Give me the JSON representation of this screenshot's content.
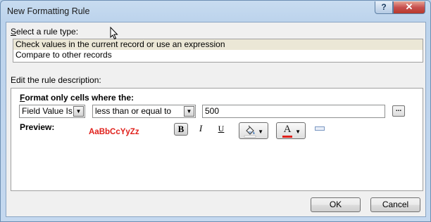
{
  "window": {
    "title": "New Formatting Rule",
    "help_glyph": "?",
    "close_glyph": "✕"
  },
  "rule_type": {
    "label_prefix": "S",
    "label_rest": "elect a rule type:",
    "items": [
      {
        "label": "Check values in the current record or use an expression",
        "selected": true
      },
      {
        "label": "Compare to other records",
        "selected": false
      }
    ]
  },
  "description": {
    "label": "Edit the rule description:",
    "format_label_prefix": "F",
    "format_label_rest": "ormat only cells where the:",
    "field_select": "Field Value Is",
    "operator_select": "less than or equal to",
    "value": "500",
    "ellipsis": "...",
    "preview_label": "Preview:",
    "preview_sample": "AaBbCcYyZz"
  },
  "format_toolbar": {
    "bold": "B",
    "italic": "I",
    "underline": "U",
    "font_color_glyph": "A",
    "font_color": "#e0201b"
  },
  "buttons": {
    "ok": "OK",
    "cancel": "Cancel"
  }
}
